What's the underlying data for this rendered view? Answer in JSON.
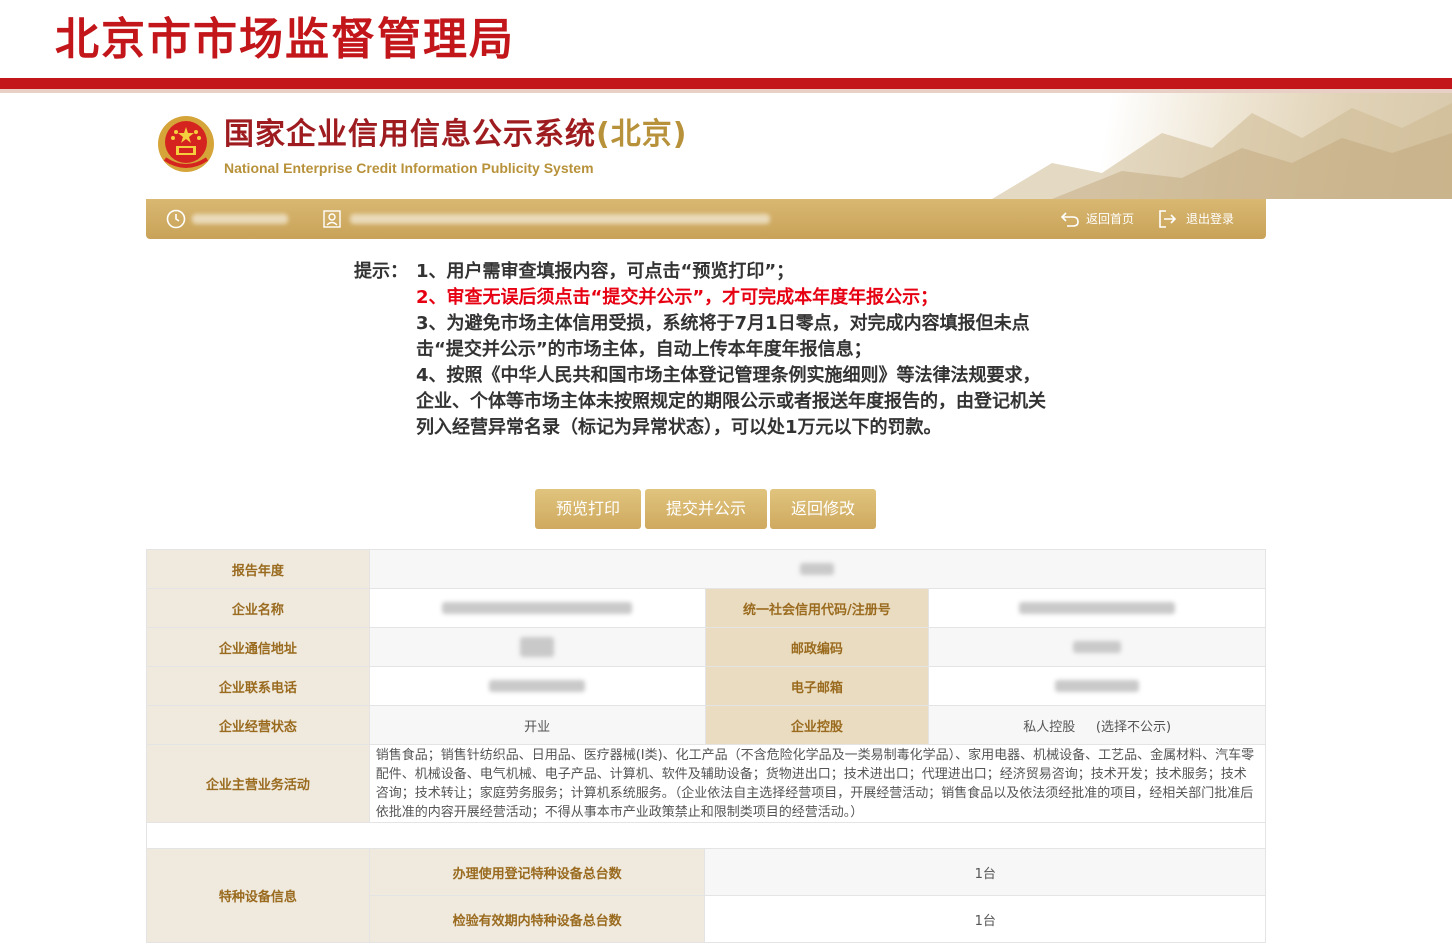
{
  "header": {
    "agency_title": "北京市市场监督管理局",
    "system_title": "国家企业信用信息公示系统",
    "system_title_suffix": "(北京)",
    "system_subtitle": "National Enterprise Credit Information Publicity System"
  },
  "navbar": {
    "home_label": "返回首页",
    "logout_label": "退出登录"
  },
  "notice": {
    "label": "提示：",
    "items": [
      "1、用户需审查填报内容，可点击“预览打印”；",
      "2、审查无误后须点击“提交并公示”，才可完成本年度年报公示；",
      "3、为避免市场主体信用受损，系统将于7月1日零点，对完成内容填报但未点击“提交并公示”的市场主体，自动上传本年度年报信息；",
      "4、按照《中华人民共和国市场主体登记管理条例实施细则》等法律法规要求，企业、个体等市场主体未按照规定的期限公示或者报送年度报告的，由登记机关列入经营异常名录（标记为异常状态），可以处1万元以下的罚款。"
    ],
    "highlight_color": "#e60012"
  },
  "buttons": {
    "preview": "预览打印",
    "submit": "提交并公示",
    "back": "返回修改"
  },
  "table": {
    "report_year_label": "报告年度",
    "company_name_label": "企业名称",
    "credit_code_label": "统一社会信用代码/注册号",
    "address_label": "企业通信地址",
    "postcode_label": "邮政编码",
    "phone_label": "企业联系电话",
    "email_label": "电子邮箱",
    "status_label": "企业经营状态",
    "status_value": "开业",
    "holding_label": "企业控股",
    "holding_value": "私人控股",
    "holding_note": "(选择不公示)",
    "business_label": "企业主营业务活动",
    "business_value": "销售食品；销售针纺织品、日用品、医疗器械(I类)、化工产品（不含危险化学品及一类易制毒化学品）、家用电器、机械设备、工艺品、金属材料、汽车零配件、机械设备、电气机械、电子产品、计算机、软件及辅助设备；货物进出口；技术进出口；代理进出口；经济贸易咨询；技术开发；技术服务；技术咨询；技术转让；家庭劳务服务；计算机系统服务。（企业依法自主选择经营项目，开展经营活动；销售食品以及依法须经批准的项目，经相关部门批准后依批准的内容开展经营活动；不得从事本市产业政策禁止和限制类项目的经营活动。）"
  },
  "equipment": {
    "section_label": "特种设备信息",
    "registered_label": "办理使用登记特种设备总台数",
    "registered_value": "1台",
    "inspected_label": "检验有效期内特种设备总台数",
    "inspected_value": "1台"
  },
  "colors": {
    "brand_red": "#c3161b",
    "gold": "#cfa95f",
    "header_cell": "#efe9de"
  }
}
